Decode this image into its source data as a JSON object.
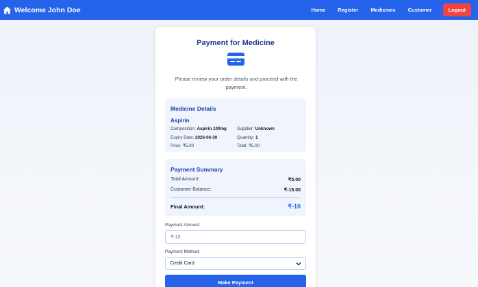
{
  "navbar": {
    "brand": "Welcome John Doe",
    "brand_icon": "home-icon",
    "links": [
      "Home",
      "Register",
      "Medicines",
      "Customer"
    ],
    "logout": "Logout"
  },
  "card": {
    "title": "Payment for Medicine",
    "icon": "credit-card-icon",
    "intro": "Please review your order details and proceed with the payment."
  },
  "medicine": {
    "heading": "Medicine Details",
    "name": "Aspirin",
    "composition_label": "Composition:",
    "composition": "Aspirin 100mg",
    "supplier_label": "Supplier:",
    "supplier": "Unknown",
    "expiry_label": "Expiry Date:",
    "expiry": "2026-06-30",
    "quantity_label": "Quantity:",
    "quantity": "1",
    "price_label": "Price:",
    "price": "₹5.00",
    "total_label": "Total:",
    "total": "₹5.00"
  },
  "summary": {
    "heading": "Payment Summary",
    "total_amount_label": "Total Amount:",
    "total_amount": "₹5.00",
    "balance_label": "Customer Balance:",
    "balance": "₹-15.00",
    "final_label": "Final Amount:",
    "final": "₹-10"
  },
  "form": {
    "amount_label": "Payment Amount:",
    "amount_placeholder": "₹-10",
    "method_label": "Payment Method:",
    "method_value": "Credit Card",
    "submit": "Make Payment"
  },
  "colors": {
    "primary": "#2563eb",
    "danger": "#ef4444",
    "heading": "#1e3a8a"
  }
}
